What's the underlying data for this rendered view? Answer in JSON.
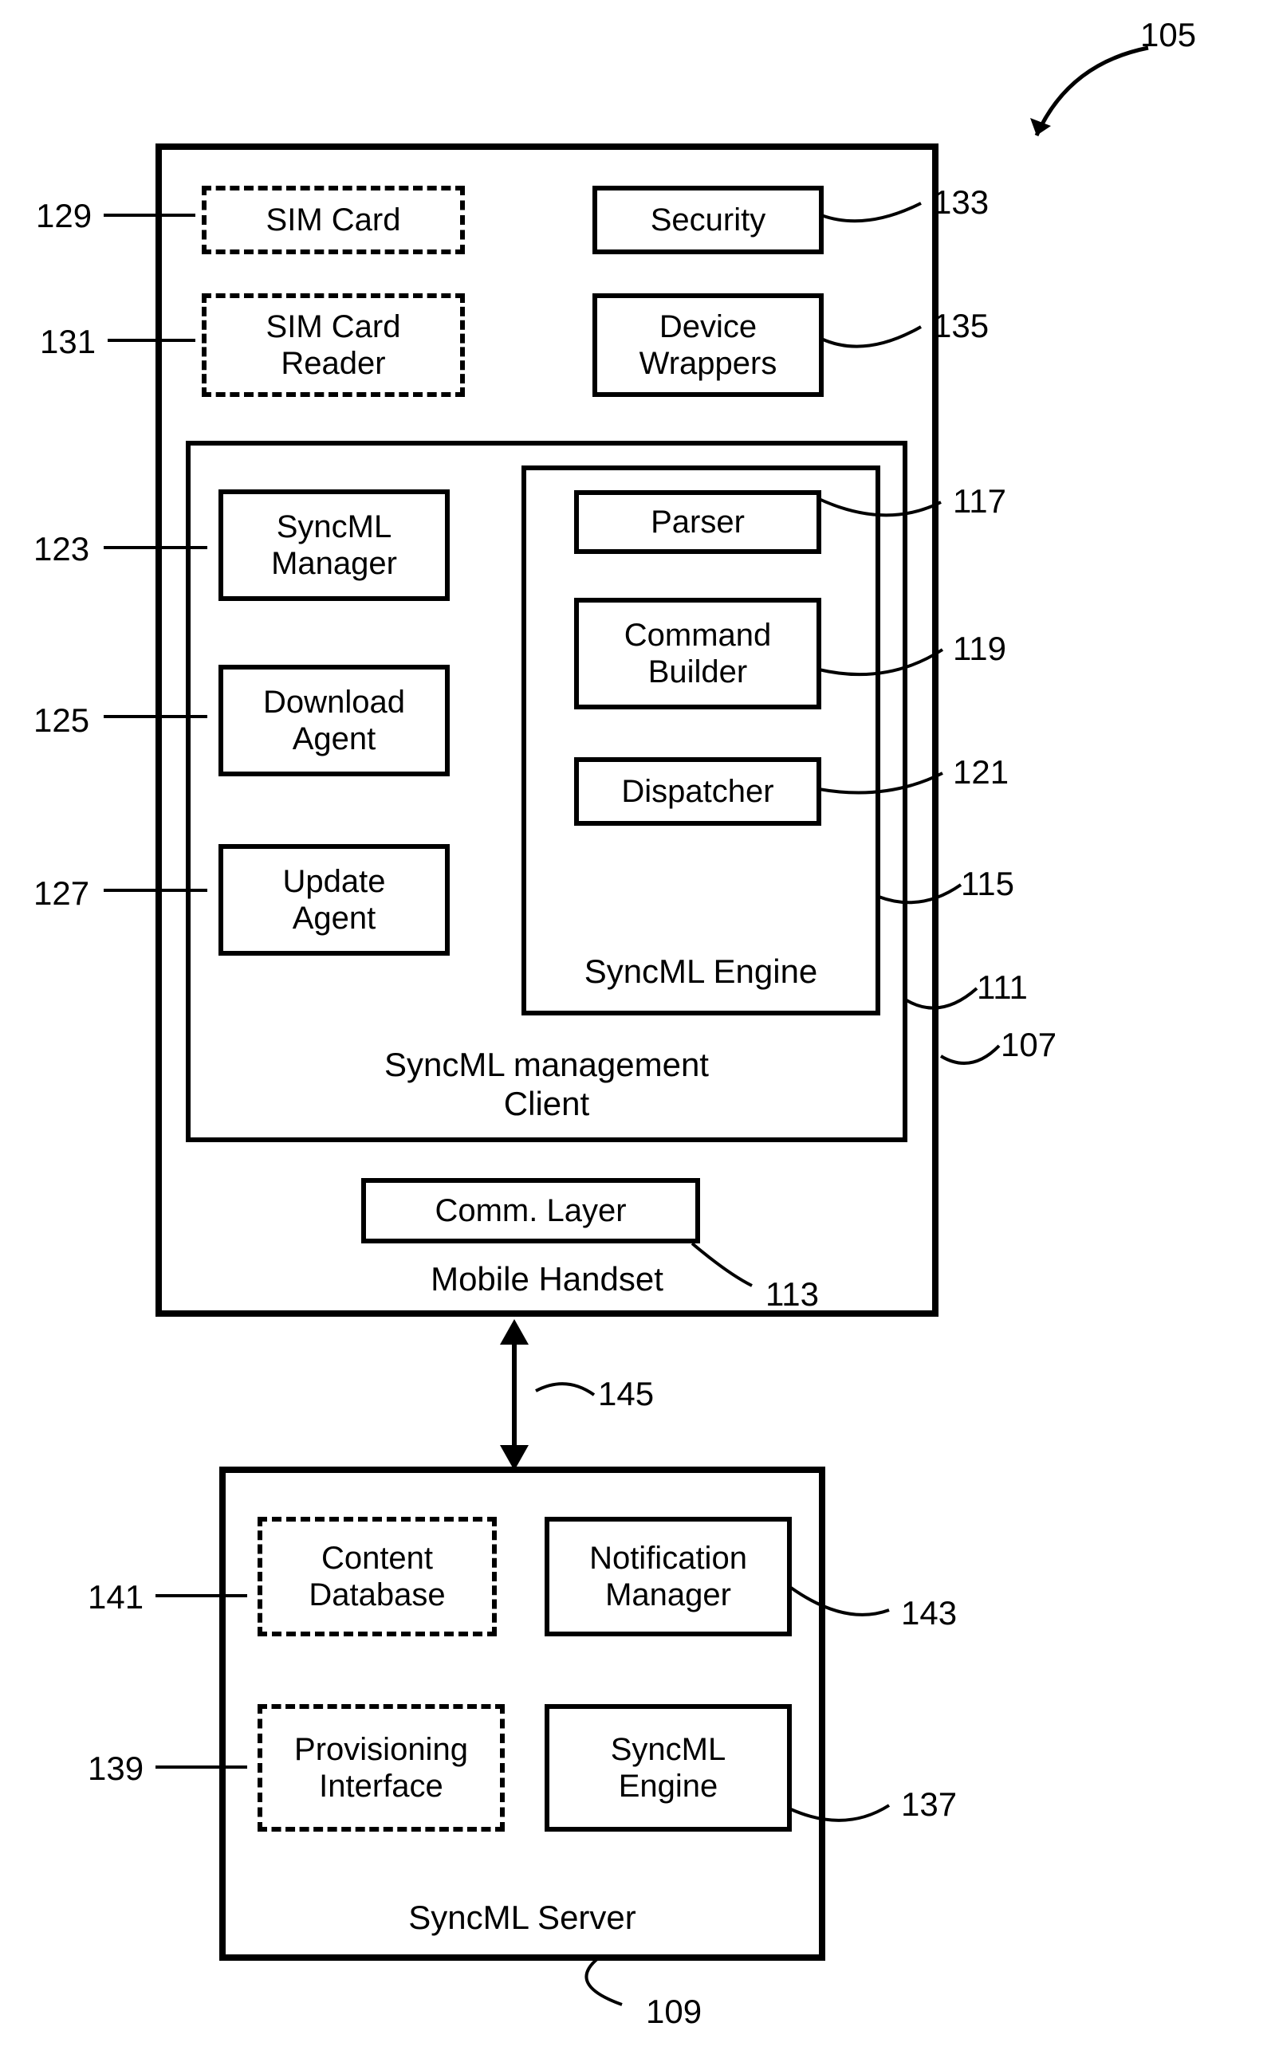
{
  "figure_ref": "105",
  "handset": {
    "caption": "Mobile Handset",
    "ref": "107",
    "sim_card": {
      "label": "SIM Card",
      "ref": "129"
    },
    "sim_reader": {
      "label": "SIM Card\nReader",
      "ref": "131"
    },
    "security": {
      "label": "Security",
      "ref": "133"
    },
    "wrappers": {
      "label": "Device\nWrappers",
      "ref": "135"
    },
    "client": {
      "caption": "SyncML management\nClient",
      "ref": "111",
      "syncml_manager": {
        "label": "SyncML\nManager",
        "ref": "123"
      },
      "download_agent": {
        "label": "Download\nAgent",
        "ref": "125"
      },
      "update_agent": {
        "label": "Update\nAgent",
        "ref": "127"
      },
      "engine": {
        "caption": "SyncML Engine",
        "ref": "115",
        "parser": {
          "label": "Parser",
          "ref": "117"
        },
        "cmd_builder": {
          "label": "Command\nBuilder",
          "ref": "119"
        },
        "dispatcher": {
          "label": "Dispatcher",
          "ref": "121"
        }
      }
    },
    "comm_layer": {
      "label": "Comm. Layer",
      "ref": "113"
    }
  },
  "link_ref": "145",
  "server": {
    "caption": "SyncML Server",
    "ref": "109",
    "content_db": {
      "label": "Content\nDatabase",
      "ref": "141"
    },
    "notif_mgr": {
      "label": "Notification\nManager",
      "ref": "143"
    },
    "prov_if": {
      "label": "Provisioning\nInterface",
      "ref": "139"
    },
    "engine": {
      "label": "SyncML\nEngine",
      "ref": "137"
    }
  }
}
